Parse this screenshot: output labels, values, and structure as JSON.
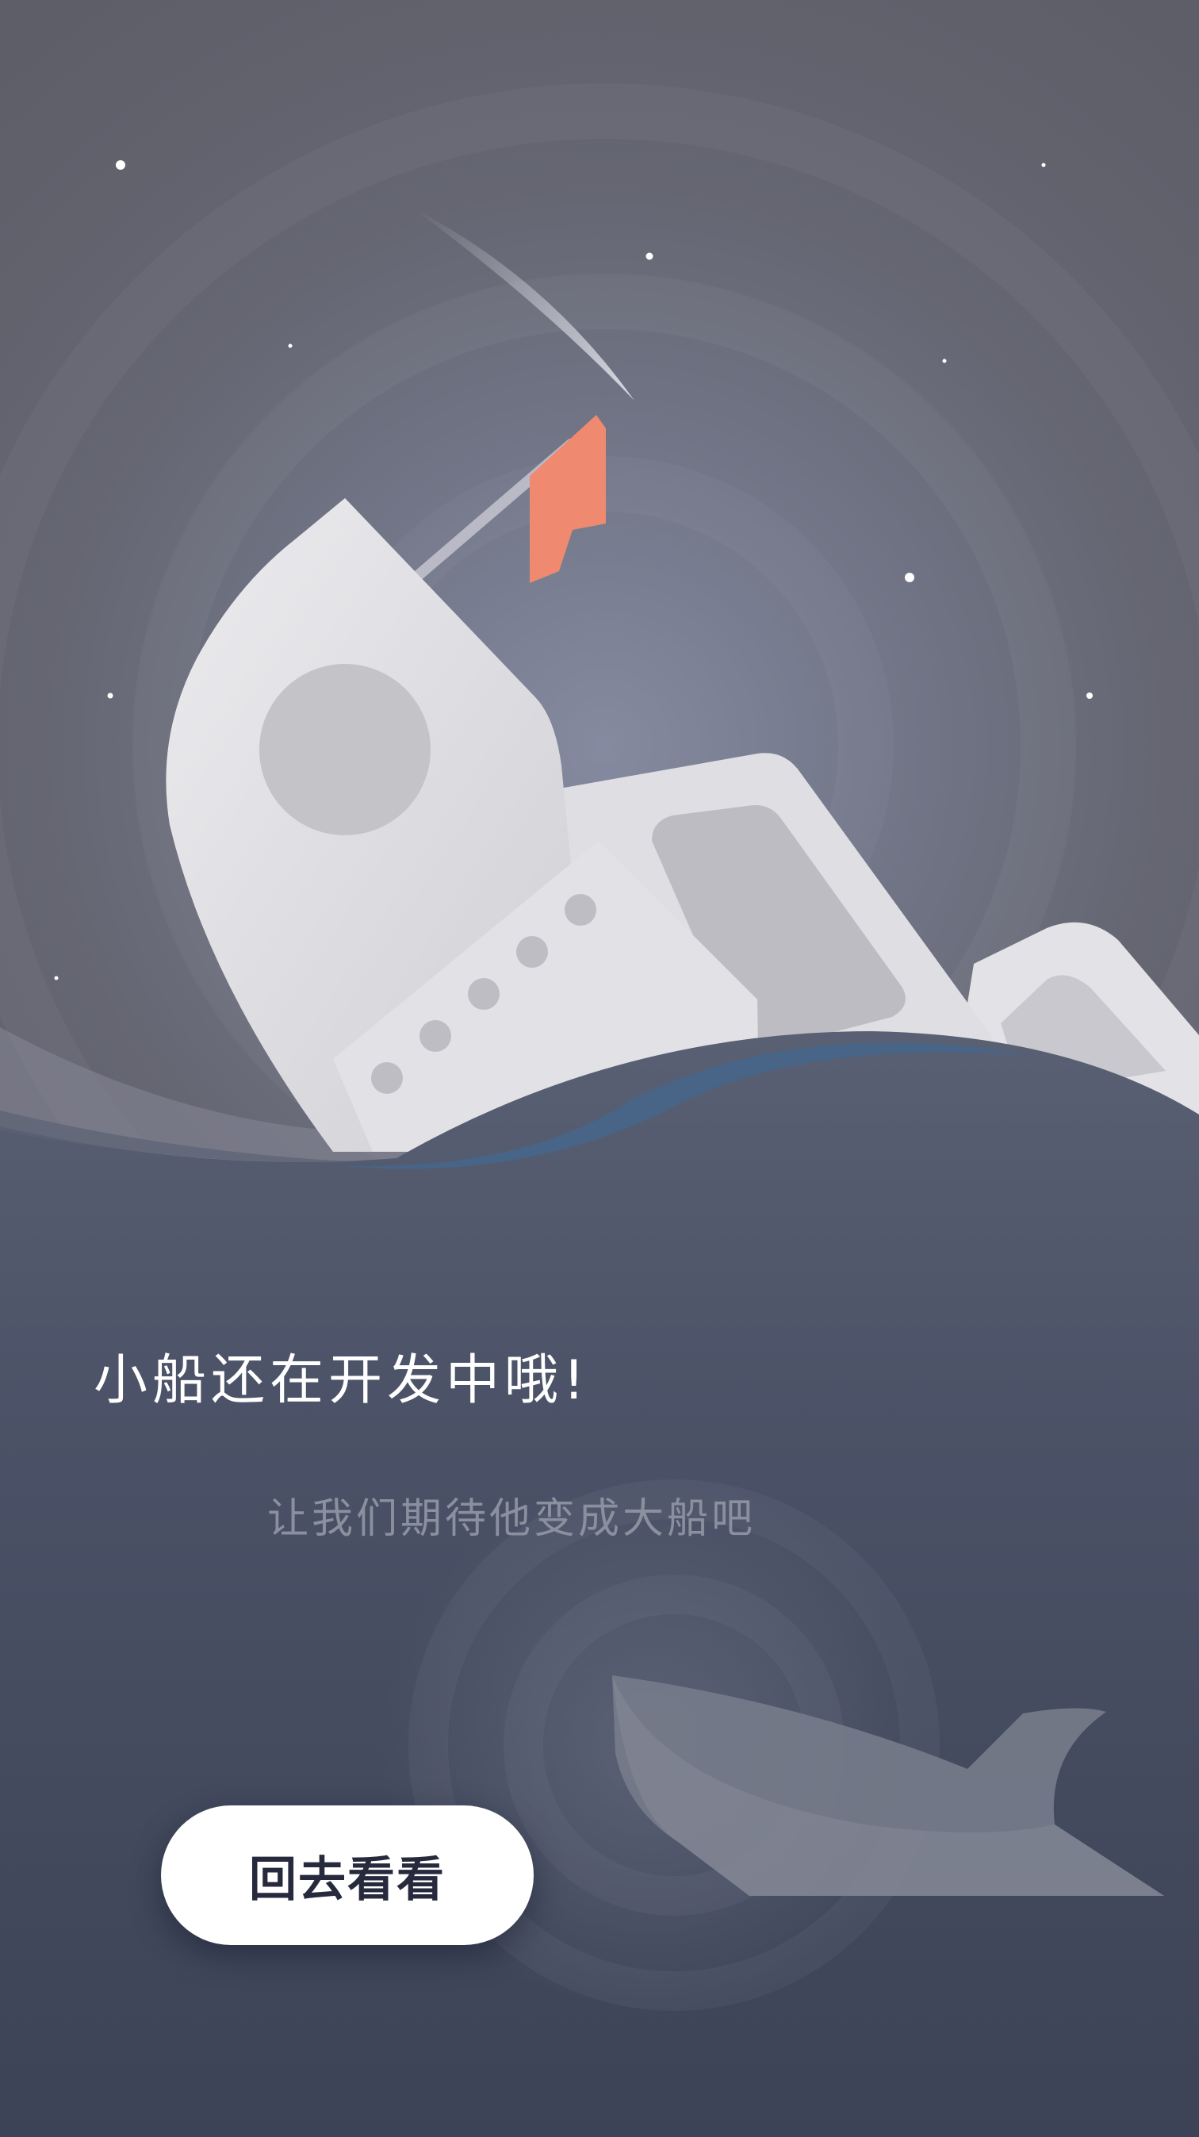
{
  "screen": {
    "title": "小船还在开发中哦!",
    "subtitle": "让我们期待他变成大船吧",
    "back_button_label": "回去看看"
  },
  "illustration": {
    "icons": [
      "sinking-ship-icon",
      "flag-icon",
      "whale-icon",
      "shooting-star-icon",
      "star-icon"
    ],
    "colors": {
      "sky_top": "#5f5f69",
      "sky_glow": "#7d8295",
      "sea_top": "#4b5266",
      "sea_bottom": "#3b4254",
      "ship": "#e6e6e9",
      "ship_shadow": "#bdbdc3",
      "flag": "#ef8a70",
      "wave": "#486487",
      "whale": "#747988",
      "button_bg": "#ffffff",
      "button_text": "#272a3d"
    }
  }
}
